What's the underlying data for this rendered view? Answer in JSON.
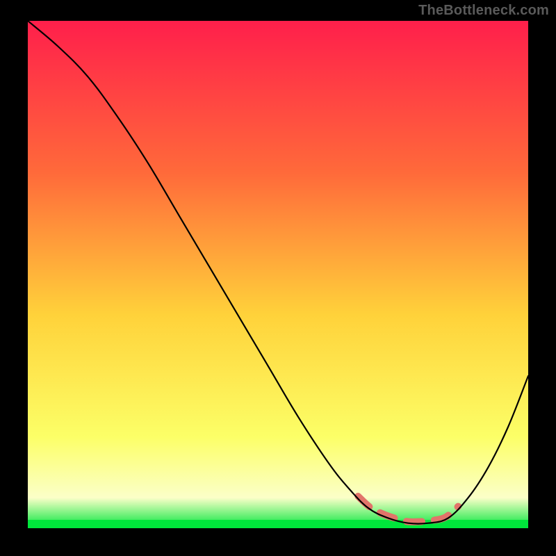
{
  "watermark": "TheBottleneck.com",
  "colors": {
    "background": "#000000",
    "gradient_top": "#ff1f4b",
    "gradient_mid_upper": "#ff6a3a",
    "gradient_mid": "#ffd23a",
    "gradient_low": "#fcff67",
    "gradient_pale": "#fbffc8",
    "gradient_bottom": "#00e63b",
    "curve": "#000000",
    "valley_marker": "#e2746a"
  },
  "chart_data": {
    "type": "line",
    "title": "",
    "xlabel": "",
    "ylabel": "",
    "xlim": [
      0,
      100
    ],
    "ylim": [
      0,
      100
    ],
    "grid": false,
    "legend": false,
    "series": [
      {
        "name": "bottleneck-curve",
        "x": [
          0,
          6,
          12,
          18,
          24,
          30,
          36,
          42,
          48,
          54,
          60,
          64,
          68,
          72,
          76,
          80,
          84,
          88,
          92,
          96,
          100
        ],
        "y": [
          100,
          95,
          89,
          81,
          72,
          62,
          52,
          42,
          32,
          22,
          13,
          8,
          4,
          2,
          1,
          1,
          2,
          6,
          12,
          20,
          30
        ]
      }
    ],
    "annotations": [
      {
        "name": "optimal-range-marker",
        "type": "segment",
        "x_range": [
          66,
          86
        ],
        "y_approx": 1.5,
        "style": "dashed",
        "color": "#e2746a"
      }
    ]
  }
}
